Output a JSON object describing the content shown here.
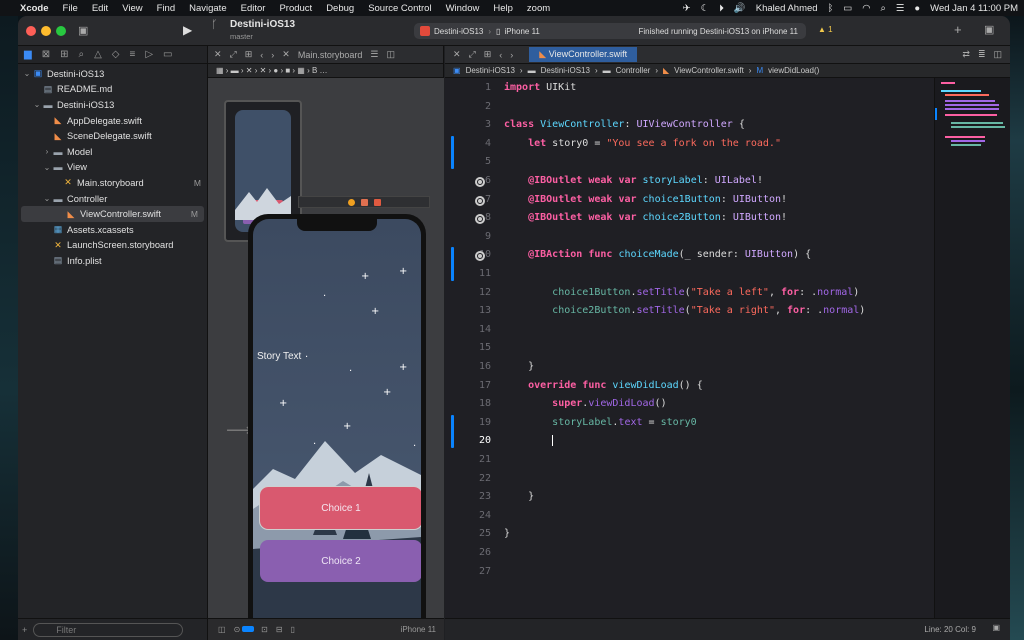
{
  "menubar": {
    "app": "Xcode",
    "items": [
      "File",
      "Edit",
      "View",
      "Find",
      "Navigate",
      "Editor",
      "Product",
      "Debug",
      "Source Control",
      "Window",
      "Help",
      "zoom"
    ],
    "user": "Khaled Ahmed",
    "clock": "Wed Jan 4  11:00 PM"
  },
  "toolbar": {
    "project": "Destini-iOS13",
    "branch": "master",
    "scheme": "Destini-iOS13",
    "device": "iPhone 11",
    "status": "Finished running Destini-iOS13 on iPhone 11",
    "warnings": "1"
  },
  "navigator": {
    "filter_placeholder": "Filter",
    "items": [
      {
        "label": "Destini-iOS13",
        "icon": "project-icon",
        "level": 0,
        "disclosure": "open",
        "status": ""
      },
      {
        "label": "README.md",
        "icon": "document-icon",
        "level": 1,
        "disclosure": "",
        "status": ""
      },
      {
        "label": "Destini-iOS13",
        "icon": "folder-icon",
        "level": 1,
        "disclosure": "open",
        "status": ""
      },
      {
        "label": "AppDelegate.swift",
        "icon": "swift-icon",
        "level": 2,
        "disclosure": "",
        "status": ""
      },
      {
        "label": "SceneDelegate.swift",
        "icon": "swift-icon",
        "level": 2,
        "disclosure": "",
        "status": ""
      },
      {
        "label": "Model",
        "icon": "folder-icon",
        "level": 2,
        "disclosure": "closed",
        "status": ""
      },
      {
        "label": "View",
        "icon": "folder-icon",
        "level": 2,
        "disclosure": "open",
        "status": ""
      },
      {
        "label": "Main.storyboard",
        "icon": "storyboard-icon",
        "level": 3,
        "disclosure": "",
        "status": "M"
      },
      {
        "label": "Controller",
        "icon": "folder-icon",
        "level": 2,
        "disclosure": "open",
        "status": ""
      },
      {
        "label": "ViewController.swift",
        "icon": "swift-icon",
        "level": 3,
        "disclosure": "",
        "status": "M"
      },
      {
        "label": "Assets.xcassets",
        "icon": "assets-icon",
        "level": 2,
        "disclosure": "",
        "status": ""
      },
      {
        "label": "LaunchScreen.storyboard",
        "icon": "storyboard-icon",
        "level": 2,
        "disclosure": "",
        "status": ""
      },
      {
        "label": "Info.plist",
        "icon": "plist-icon",
        "level": 2,
        "disclosure": "",
        "status": ""
      }
    ]
  },
  "ib": {
    "tab": "Main.storyboard",
    "story_text": "Story Text",
    "choice1": "Choice 1",
    "choice2": "Choice 2",
    "device": "iPhone 11"
  },
  "editor": {
    "tab": "ViewController.swift",
    "jumpbar": [
      "Destini-iOS13",
      "Destini-iOS13",
      "Controller",
      "ViewController.swift",
      "viewDidLoad()"
    ],
    "line_count": 27,
    "current_line": 20,
    "status": "Line: 20  Col: 9"
  },
  "colors": {
    "choice1": "#d9596f",
    "choice2": "#8a5fb0",
    "accent": "#0a84ff"
  }
}
